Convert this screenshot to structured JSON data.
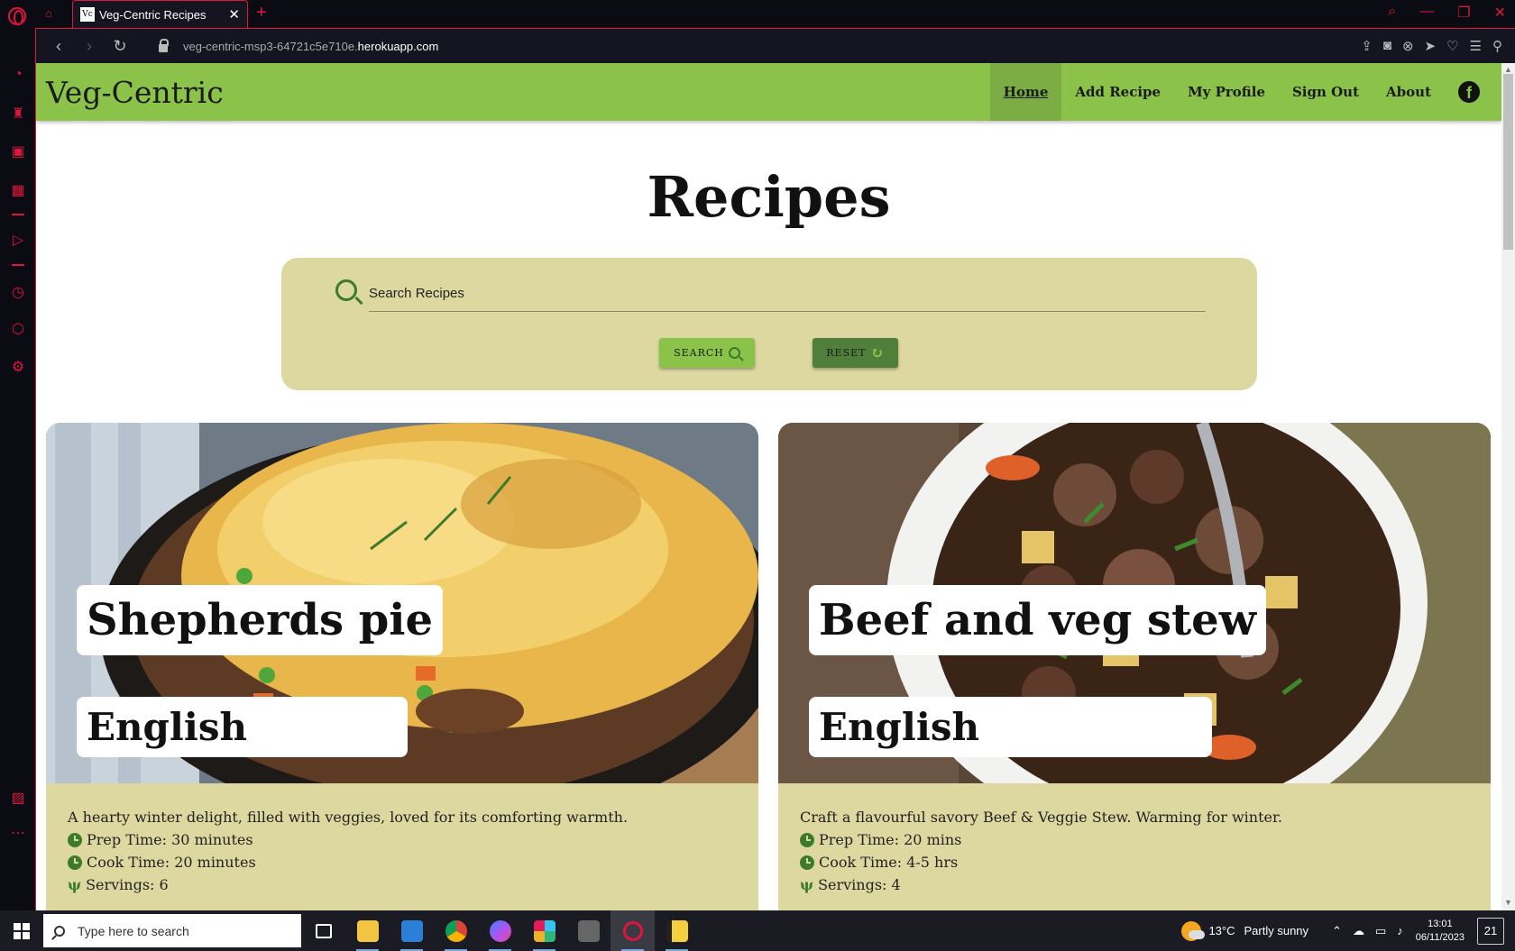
{
  "browser": {
    "tab_title": "Veg-Centric Recipes",
    "url_prefix": "veg-centric-msp3-64721c5e710e.",
    "url_domain": "herokuapp.com",
    "accent": "#e0143c"
  },
  "site": {
    "brand": "Veg-Centric",
    "nav": [
      "Home",
      "Add Recipe",
      "My Profile",
      "Sign Out",
      "About"
    ],
    "nav_color": "#8bc34a"
  },
  "main": {
    "title": "Recipes",
    "search": {
      "placeholder": "Search Recipes"
    },
    "search_button": "SEARCH",
    "reset_button": "RESET",
    "panel_color": "#ddd8a0"
  },
  "recipes": [
    {
      "name": "Shepherds pie",
      "cuisine": "English",
      "description": "A hearty winter delight, filled with veggies, loved for its comforting warmth.",
      "prep": "Prep Time: 30 minutes",
      "cook": "Cook Time: 20 minutes",
      "servings": "Servings: 6"
    },
    {
      "name": "Beef and veg stew",
      "cuisine": "English",
      "description": "Craft a flavourful savory Beef & Veggie Stew. Warming for winter.",
      "prep": "Prep Time: 20 mins",
      "cook": "Cook Time: 4-5 hrs",
      "servings": "Servings: 4"
    }
  ],
  "taskbar": {
    "search_placeholder": "Type here to search",
    "weather_temp": "13°C",
    "weather_desc": "Partly sunny",
    "time": "13:01",
    "date": "06/11/2023",
    "notifications": "21"
  }
}
